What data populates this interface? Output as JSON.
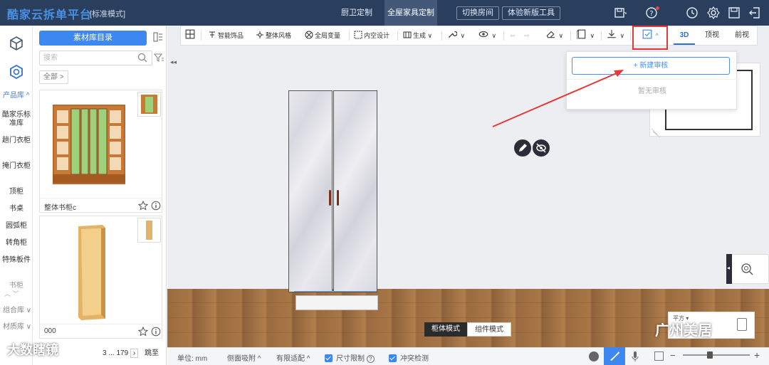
{
  "header": {
    "brand": "酷家云拆单平台",
    "mode": "[标准模式]",
    "tabs": [
      {
        "label": "厨卫定制",
        "active": false
      },
      {
        "label": "全屋家具定制",
        "active": true
      }
    ],
    "buttons": [
      "切换房间",
      "体验新版工具"
    ],
    "icons": [
      "save-icon",
      "help-icon",
      "history-icon",
      "settings-icon",
      "disk-icon",
      "exit-icon"
    ]
  },
  "left_nav": {
    "sections": {
      "product": "产品库 ^",
      "combo": "组合库 ∨",
      "material": "材质库 ∨"
    },
    "items": [
      "酷家乐标准库",
      "趟门衣柜",
      "掩门衣柜",
      "顶柜",
      "书桌",
      "圆弧柜",
      "转角柜",
      "特殊板件",
      "书柜"
    ]
  },
  "panel": {
    "catalog_button": "素材库目录",
    "search_placeholder": "搜索",
    "crumb": "全部 >",
    "cards": [
      {
        "name": "整体书柜c"
      },
      {
        "name": "000"
      }
    ],
    "pager": "3 ... 179",
    "pager_jump": "跳至"
  },
  "toolbar": {
    "items": [
      "智能饰品",
      "整体风格",
      "全局变量",
      "内空设计",
      "生成 ∨"
    ],
    "views": [
      {
        "label": "3D",
        "active": true
      },
      {
        "label": "顶视",
        "active": false
      },
      {
        "label": "前视",
        "active": false
      }
    ]
  },
  "review_dropdown": {
    "new_label": "+ 新建审核",
    "empty_label": "暂无审核"
  },
  "mode_switch": {
    "cabinet": "柜体模式",
    "component": "组件模式"
  },
  "compass": {
    "label": "平方 ▾"
  },
  "statusbar": {
    "unit_label": "单位: mm",
    "side_snap": "侧面吸附 ^",
    "limited_fit": "有限适配 ^",
    "size_limit": "尺寸限制",
    "conflict_check": "冲突检测"
  },
  "watermarks": {
    "left": "大数瞎镜",
    "right": "广州美居"
  },
  "colors": {
    "topbar": "#2a3e5e",
    "accent": "#3d87f0",
    "highlight": "#e53935",
    "annotation_arrow": "#e53935"
  }
}
